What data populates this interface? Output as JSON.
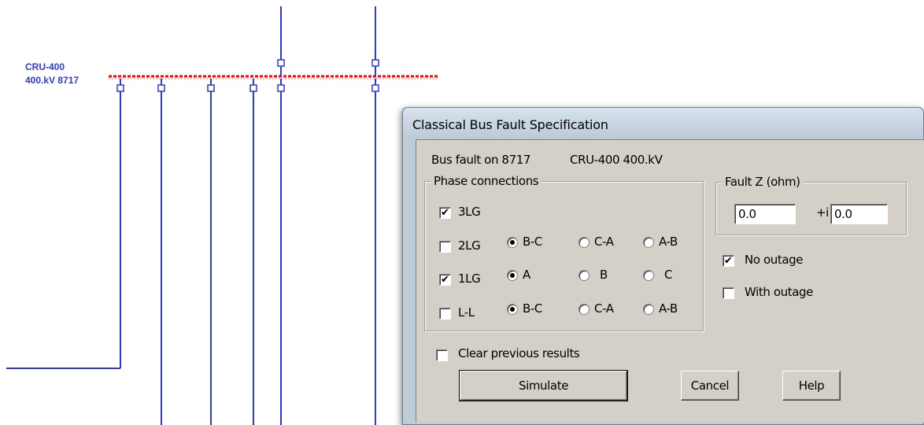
{
  "diagram": {
    "bus_name": "CRU-400",
    "bus_voltage_id": "400.kV 8717",
    "line_color": "#2f38d8",
    "fault_color": "#ff0000"
  },
  "dialog": {
    "title": "Classical Bus Fault Specification",
    "info": {
      "bus_fault_on": "Bus fault on 8717",
      "bus_name_kv": "CRU-400  400.kV"
    },
    "phase_connections": {
      "title": "Phase connections",
      "rows": [
        {
          "label": "3LG",
          "checked": true,
          "options": []
        },
        {
          "label": "2LG",
          "checked": false,
          "options": [
            "B-C",
            "C-A",
            "A-B"
          ],
          "selected": "B-C"
        },
        {
          "label": "1LG",
          "checked": true,
          "options": [
            "A",
            "B",
            "C"
          ],
          "selected": "A"
        },
        {
          "label": "L-L",
          "checked": false,
          "options": [
            "B-C",
            "C-A",
            "A-B"
          ],
          "selected": "B-C"
        }
      ]
    },
    "fault_z": {
      "title": "Fault Z (ohm)",
      "real": "0.0",
      "imag_label": "+i",
      "imag": "0.0"
    },
    "no_outage": {
      "label": "No outage",
      "checked": true
    },
    "with_outage": {
      "label": "With outage",
      "checked": false
    },
    "clear_previous": {
      "label": "Clear previous results",
      "checked": false
    },
    "buttons": {
      "simulate": "Simulate",
      "cancel": "Cancel",
      "help": "Help"
    }
  }
}
